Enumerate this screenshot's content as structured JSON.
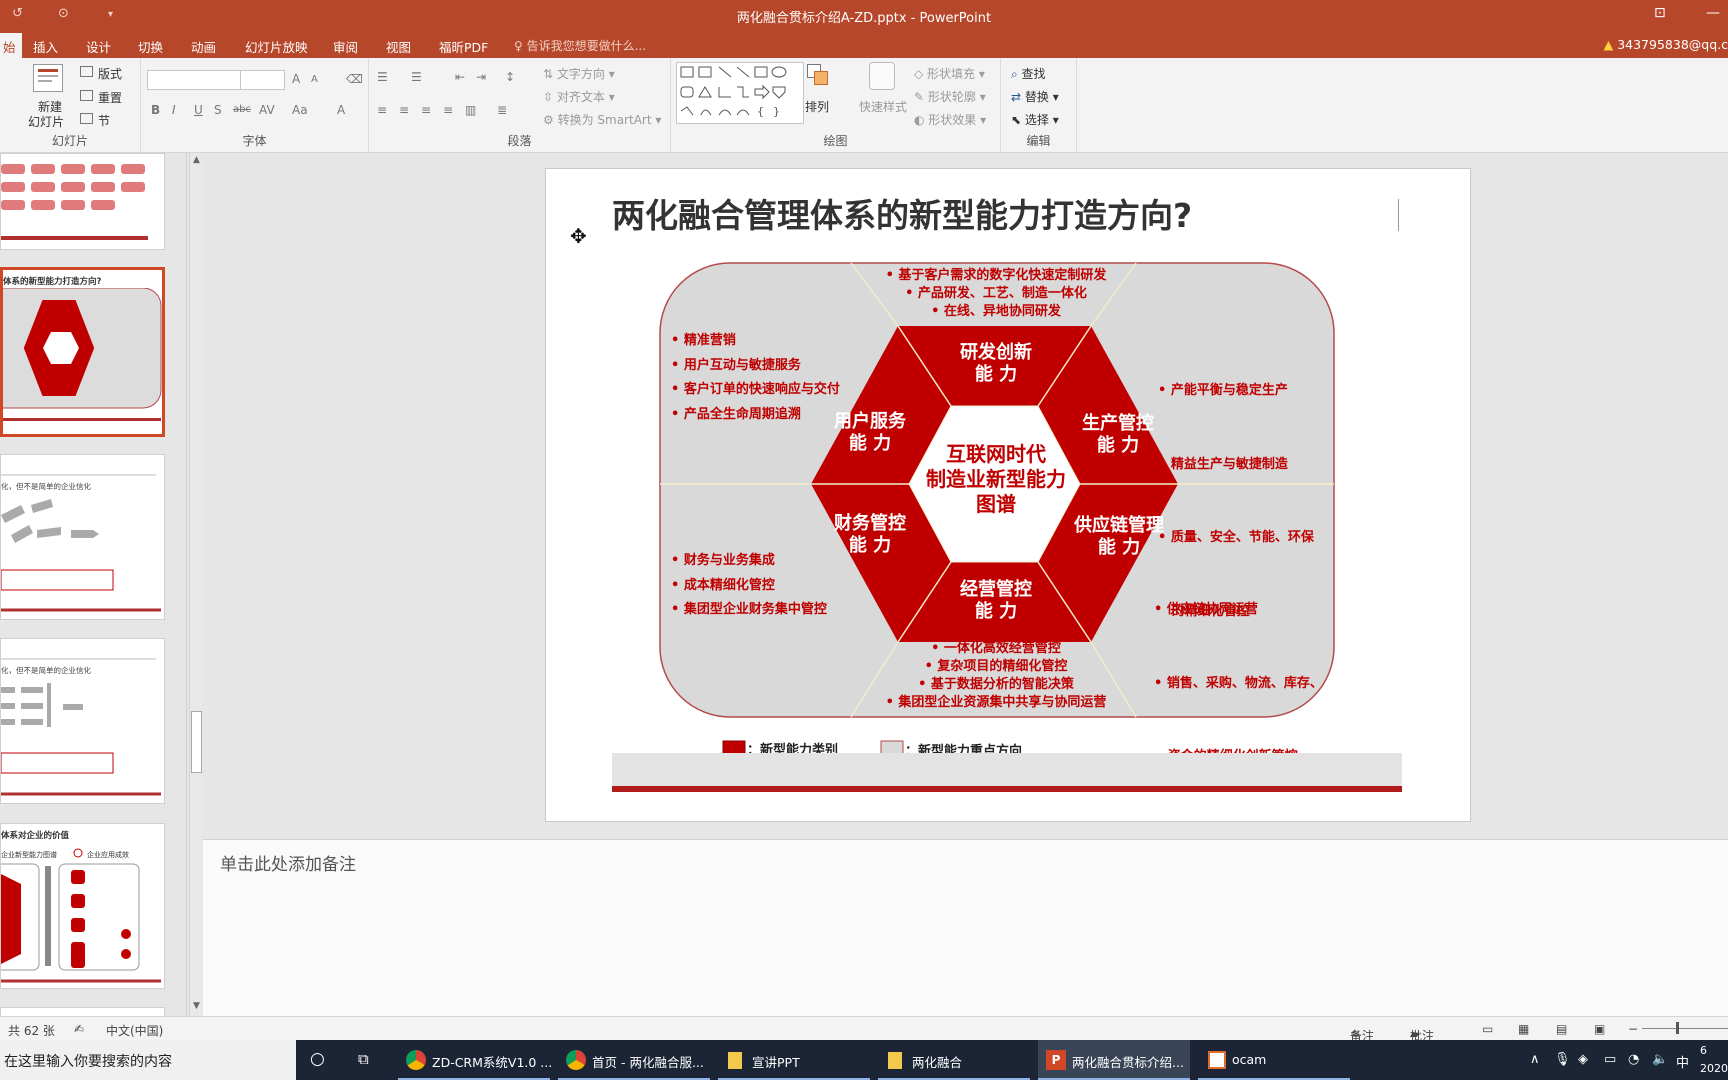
{
  "window": {
    "title": "两化融合贯标介绍A-ZD.pptx - PowerPoint"
  },
  "tabs": [
    {
      "label": "插入"
    },
    {
      "label": "设计"
    },
    {
      "label": "切换"
    },
    {
      "label": "动画"
    },
    {
      "label": "幻灯片放映"
    },
    {
      "label": "审阅"
    },
    {
      "label": "视图"
    },
    {
      "label": "福昕PDF"
    }
  ],
  "home_tab_partial": "始",
  "tell_me": "告诉我您想要做什么...",
  "account": "343795838@qq.c",
  "ribbon": {
    "slides": {
      "new_slide": "新建",
      "new_slide2": "幻灯片",
      "layout": "版式",
      "reset": "重置",
      "section": "节",
      "label": "幻灯片"
    },
    "font": {
      "label": "字体",
      "bold": "B",
      "italic": "I",
      "underline": "U",
      "shadow": "S",
      "strike": "abc",
      "spacing": "AV",
      "case": "Aa",
      "color": "A"
    },
    "paragraph": {
      "label": "段落",
      "text_direction": "文字方向",
      "align_text": "对齐文本",
      "smartart": "转换为 SmartArt"
    },
    "drawing": {
      "label": "绘图",
      "arrange": "排列",
      "quick_styles": "快速样式",
      "shape_fill": "形状填充",
      "shape_outline": "形状轮廓",
      "shape_effects": "形状效果"
    },
    "editing": {
      "label": "编辑",
      "find": "查找",
      "replace": "替换",
      "select": "选择"
    }
  },
  "thumbnails": {
    "t2_title": "体系的新型能力打造方向?",
    "t3_title": "化，但不是简单的企业信化",
    "t4_title": "化，但不是简单的企业信化",
    "t5_title": "体系对企业的价值",
    "t5_sub1": "企业新型能力图谱",
    "t5_sub2": "企业应用成效"
  },
  "slide": {
    "title": "两化融合管理体系的新型能力打造方向?",
    "center": [
      "互联网时代",
      "制造业新型能力",
      "图谱"
    ],
    "segments": {
      "top": [
        "研发创新",
        "能 力"
      ],
      "upper_left": [
        "用户服务",
        "能 力"
      ],
      "upper_right": [
        "生产管控",
        "能 力"
      ],
      "lower_left": [
        "财务管控",
        "能 力"
      ],
      "lower_right": [
        "供应链管理",
        "能 力"
      ],
      "bottom": [
        "经营管控",
        "能 力"
      ]
    },
    "bullets": {
      "top": [
        "• 基于客户需求的数字化快速定制研发",
        "• 产品研发、工艺、制造一体化",
        "• 在线、异地协同研发"
      ],
      "upper_left": [
        "• 精准营销",
        "• 用户互动与敏捷服务",
        "• 客户订单的快速响应与交付",
        "• 产品全生命周期追溯"
      ],
      "upper_right": [
        "• 产能平衡与稳定生产",
        "• 精益生产与敏捷制造",
        "• 质量、安全、节能、环保",
        "   的精细化管控"
      ],
      "lower_left": [
        "• 财务与业务集成",
        "• 成本精细化管控",
        "• 集团型企业财务集中管控"
      ],
      "lower_right": [
        "• 供应链协同运营",
        "• 销售、采购、物流、库存、",
        "   资金的精细化创新管控"
      ],
      "bottom": [
        "• 一体化高效经营管控",
        "• 复杂项目的精细化管控",
        "• 基于数据分析的智能决策",
        "• 集团型企业资源集中共享与协同运营"
      ]
    },
    "legend": [
      "：新型能力类别",
      "：新型能力重点方向"
    ],
    "colors": {
      "accent": "#c00000",
      "bg_panel": "#d9d9d9",
      "border": "#b44a4a"
    }
  },
  "notes_placeholder": "单击此处添加备注",
  "status": {
    "slide_count": "共 62 张",
    "language": "中文(中国)",
    "notes": "备注",
    "comments": "批注"
  },
  "taskbar": {
    "search": "在这里输入你要搜索的内容",
    "items": [
      "ZD-CRM系统V1.0 ...",
      "首页 - 两化融合服...",
      "宣讲PPT",
      "两化融合",
      "两化融合贯标介绍...",
      "ocam"
    ],
    "ime": "中",
    "year": "2020",
    "time": "6"
  }
}
